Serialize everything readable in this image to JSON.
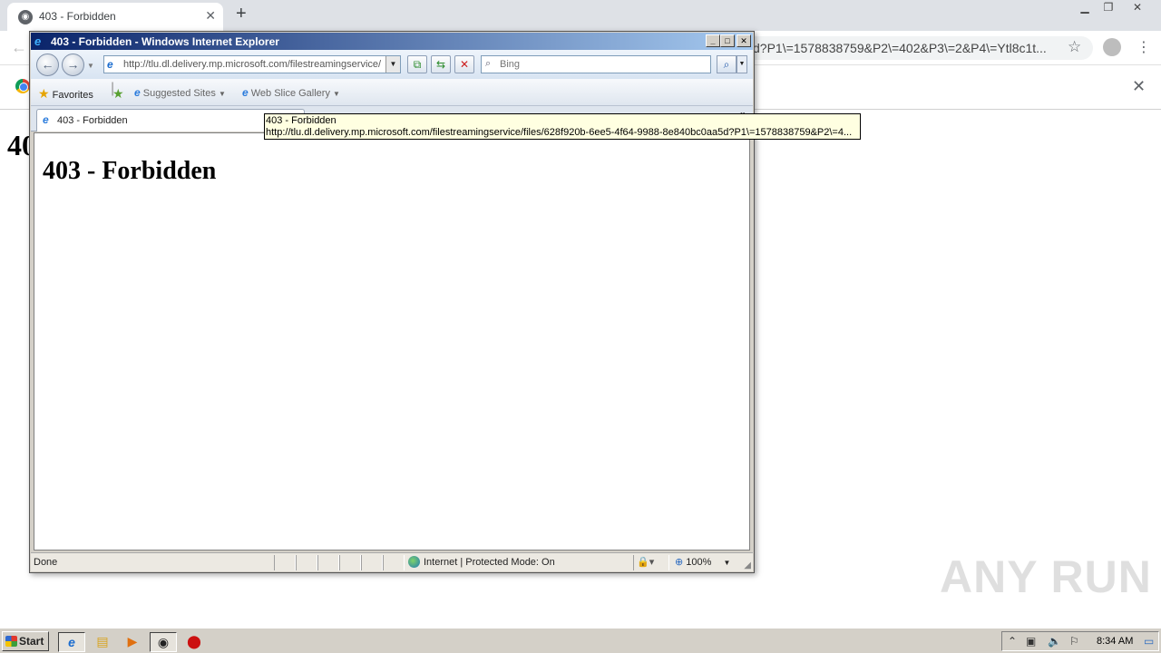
{
  "chrome": {
    "tab_title": "403 - Forbidden",
    "tab_close": "✕",
    "new_tab": "+",
    "omnibox_visible": "d?P1\\=1578838759&P2\\=402&P3\\=2&P4\\=Ytl8c1t...",
    "page_heading_partial": "40",
    "infobar_close": "✕"
  },
  "ie": {
    "window_title": "403 - Forbidden - Windows Internet Explorer",
    "address_url": "http://tlu.dl.delivery.mp.microsoft.com/filestreamingservice/",
    "search_placeholder": "Bing",
    "favorites_label": "Favorites",
    "suggested_sites_label": "Suggested Sites",
    "web_slice_gallery_label": "Web Slice Gallery",
    "tab_title": "403 - Forbidden",
    "page_heading": "403 - Forbidden",
    "tooltip_title": "403 - Forbidden",
    "tooltip_url": "http://tlu.dl.delivery.mp.microsoft.com/filestreamingservice/files/628f920b-6ee5-4f64-9988-8e840bc0aa5d?P1\\=1578838759&P2\\=4...",
    "status_text": "Done",
    "zone_text": "Internet | Protected Mode: On",
    "zoom_level": "100%"
  },
  "watermark_text": "ANY RUN",
  "taskbar": {
    "start_label": "Start",
    "clock": "8:34 AM"
  }
}
